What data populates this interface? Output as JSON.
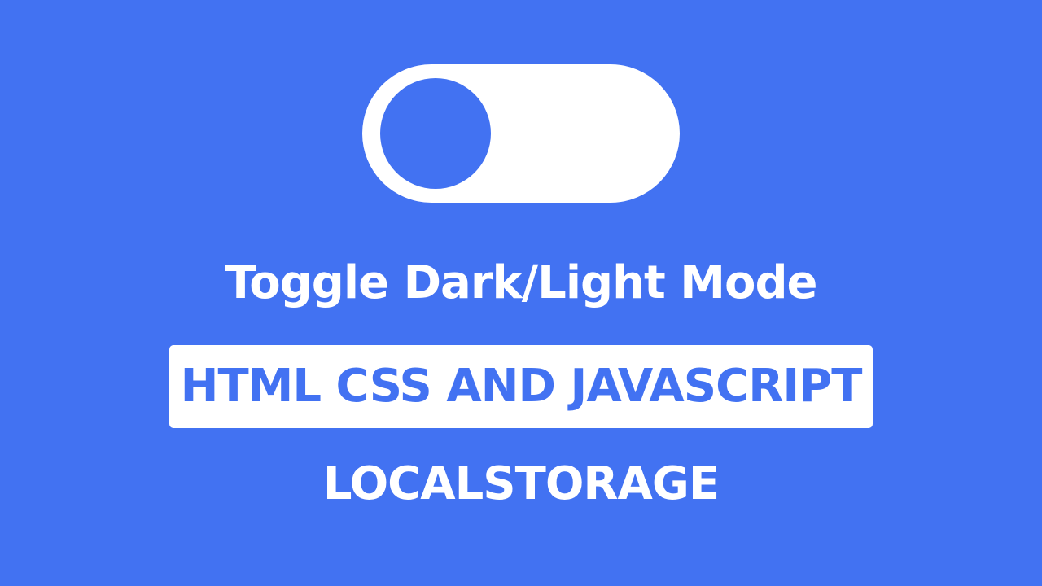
{
  "theme": {
    "background": "#4272f2",
    "accent": "#4272f2",
    "foreground": "#ffffff"
  },
  "toggle": {
    "state": "off",
    "knob_position": "left"
  },
  "title": "Toggle Dark/Light Mode",
  "badge": "HTML CSS AND JAVASCRIPT",
  "subtitle": "LOCALSTORAGE"
}
